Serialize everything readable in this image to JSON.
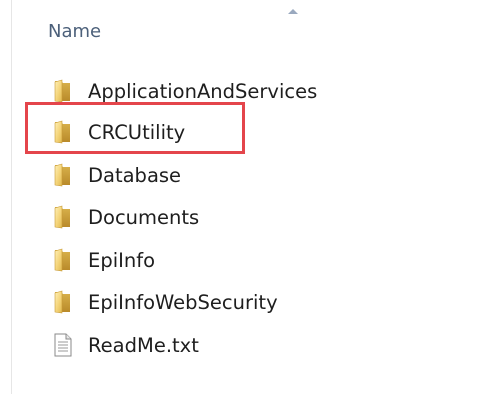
{
  "column_header": "Name",
  "items": [
    {
      "label": "ApplicationAndServices",
      "icon": "folder-icon"
    },
    {
      "label": "CRCUtility",
      "icon": "folder-icon"
    },
    {
      "label": "Database",
      "icon": "folder-icon"
    },
    {
      "label": "Documents",
      "icon": "folder-icon"
    },
    {
      "label": "EpiInfo",
      "icon": "folder-icon"
    },
    {
      "label": "EpiInfoWebSecurity",
      "icon": "folder-icon"
    },
    {
      "label": "ReadMe.txt",
      "icon": "text-file-icon"
    }
  ],
  "highlight_color": "#e4454b"
}
